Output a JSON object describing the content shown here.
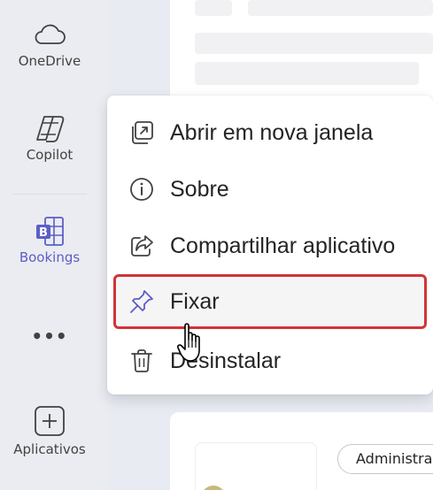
{
  "rail": {
    "items": [
      {
        "label": "OneDrive",
        "icon": "cloud-icon"
      },
      {
        "label": "Copilot",
        "icon": "copilot-icon"
      },
      {
        "label": "Bookings",
        "icon": "bookings-icon",
        "active": true
      },
      {
        "label": "•••",
        "icon": "more-icon"
      },
      {
        "label": "Aplicativos",
        "icon": "add-apps-icon"
      }
    ]
  },
  "menu": {
    "items": [
      {
        "label": "Abrir em nova janela",
        "icon": "open-new-window-icon"
      },
      {
        "label": "Sobre",
        "icon": "info-icon"
      },
      {
        "label": "Compartilhar aplicativo",
        "icon": "share-icon"
      },
      {
        "label": "Fixar",
        "icon": "pin-icon",
        "highlighted": true
      },
      {
        "label": "Desinstalar",
        "icon": "trash-icon"
      }
    ]
  },
  "content": {
    "admin_pill": "Administra"
  },
  "colors": {
    "accent": "#5b5fc7",
    "highlight_border": "#d13438"
  }
}
